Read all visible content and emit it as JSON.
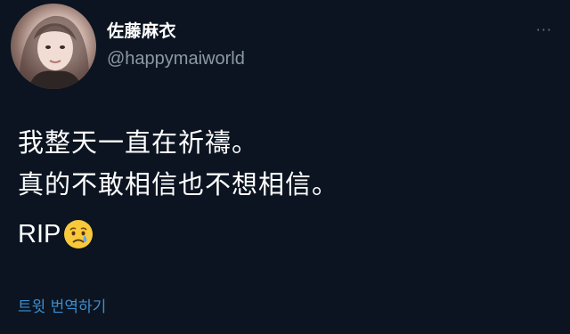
{
  "tweet": {
    "author": {
      "display_name": "佐藤麻衣",
      "handle": "@happymaiworld",
      "avatar_icon": "avatar"
    },
    "more_label": "···",
    "text_lines": [
      "我整天一直在祈禱。",
      "真的不敢相信也不想相信。"
    ],
    "closing_text": "RIP",
    "closing_emoji": "crying-face-icon",
    "translate_label": "트윗 번역하기"
  },
  "colors": {
    "background": "#0b1420",
    "text": "#ffffff",
    "muted": "#8b98a5",
    "link": "#3e8ed0"
  }
}
